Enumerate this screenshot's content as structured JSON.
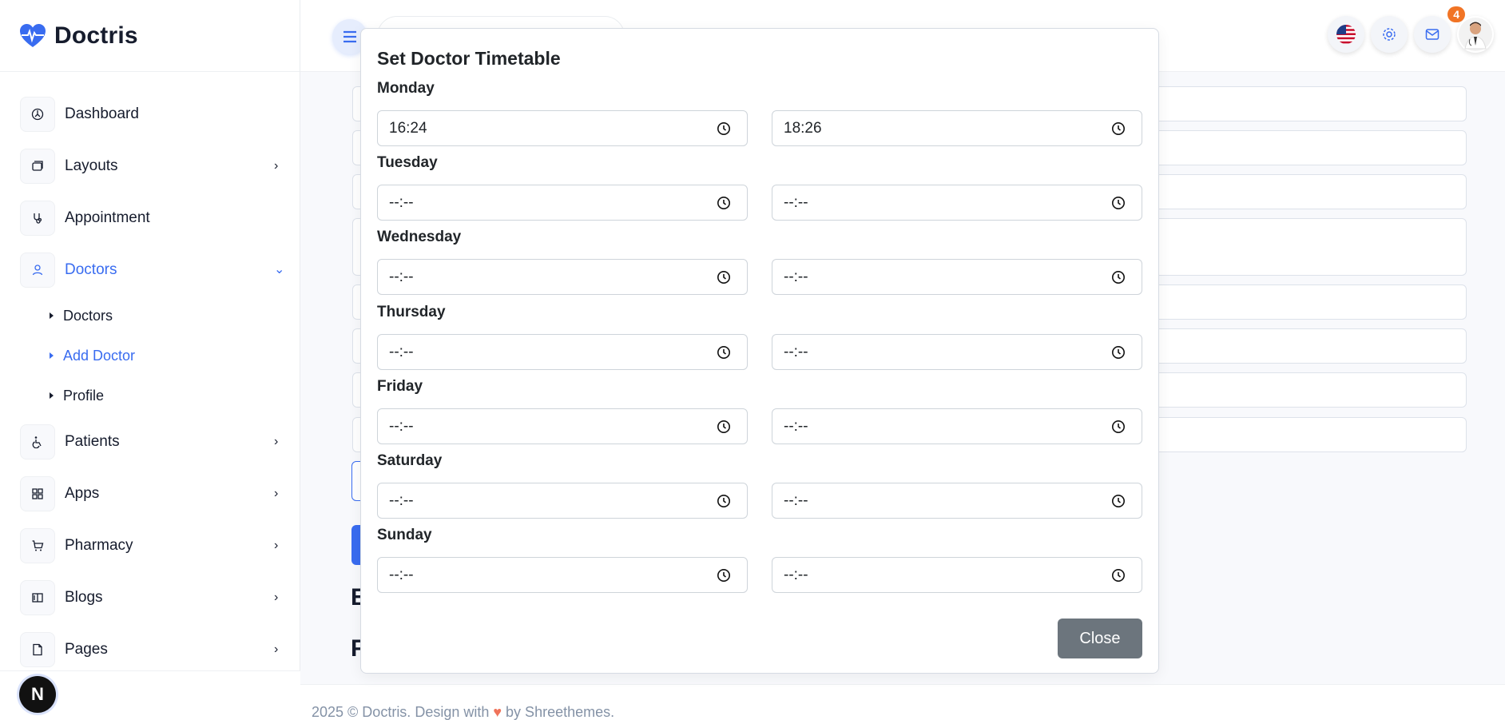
{
  "brand": {
    "name": "Doctris"
  },
  "sidebar": {
    "items": [
      {
        "label": "Dashboard",
        "icon": "dashboard-icon"
      },
      {
        "label": "Layouts",
        "icon": "layouts-icon"
      },
      {
        "label": "Appointment",
        "icon": "stethoscope-icon"
      },
      {
        "label": "Doctors",
        "icon": "user-icon"
      },
      {
        "label": "Patients",
        "icon": "wheelchair-icon"
      },
      {
        "label": "Apps",
        "icon": "apps-icon"
      },
      {
        "label": "Pharmacy",
        "icon": "cart-icon"
      },
      {
        "label": "Blogs",
        "icon": "book-icon"
      },
      {
        "label": "Pages",
        "icon": "file-icon"
      }
    ],
    "doctors_sub": [
      {
        "label": "Doctors"
      },
      {
        "label": "Add Doctor"
      },
      {
        "label": "Profile"
      }
    ],
    "footer_badge": "N"
  },
  "topbar": {
    "notification_count": "4",
    "accent": "#396cf0"
  },
  "footer": {
    "prefix": "2025 © Doctris. Design with ",
    "suffix": " by Shreethemes."
  },
  "background": {
    "heading1": "E",
    "heading2": "F"
  },
  "modal": {
    "title": "Set Doctor Timetable",
    "days": [
      {
        "name": "Monday",
        "start": "16:24",
        "end": "18:26"
      },
      {
        "name": "Tuesday",
        "start": "--:--",
        "end": "--:--"
      },
      {
        "name": "Wednesday",
        "start": "--:--",
        "end": "--:--"
      },
      {
        "name": "Thursday",
        "start": "--:--",
        "end": "--:--"
      },
      {
        "name": "Friday",
        "start": "--:--",
        "end": "--:--"
      },
      {
        "name": "Saturday",
        "start": "--:--",
        "end": "--:--"
      },
      {
        "name": "Sunday",
        "start": "--:--",
        "end": "--:--"
      }
    ],
    "close_label": "Close"
  }
}
